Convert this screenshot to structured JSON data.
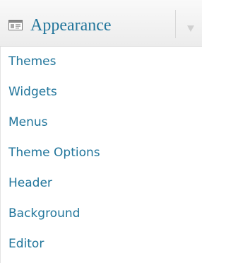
{
  "menu": {
    "title": "Appearance",
    "icon": "appearance-icon",
    "toggle_icon": "chevron-down-icon",
    "items": [
      {
        "label": "Themes",
        "name": "themes"
      },
      {
        "label": "Widgets",
        "name": "widgets"
      },
      {
        "label": "Menus",
        "name": "menus"
      },
      {
        "label": "Theme Options",
        "name": "theme-options"
      },
      {
        "label": "Header",
        "name": "header"
      },
      {
        "label": "Background",
        "name": "background"
      },
      {
        "label": "Editor",
        "name": "editor"
      }
    ]
  },
  "colors": {
    "link": "#21759b",
    "header_background": "#ececec",
    "toggle_arrow": "#d0d0d0"
  }
}
